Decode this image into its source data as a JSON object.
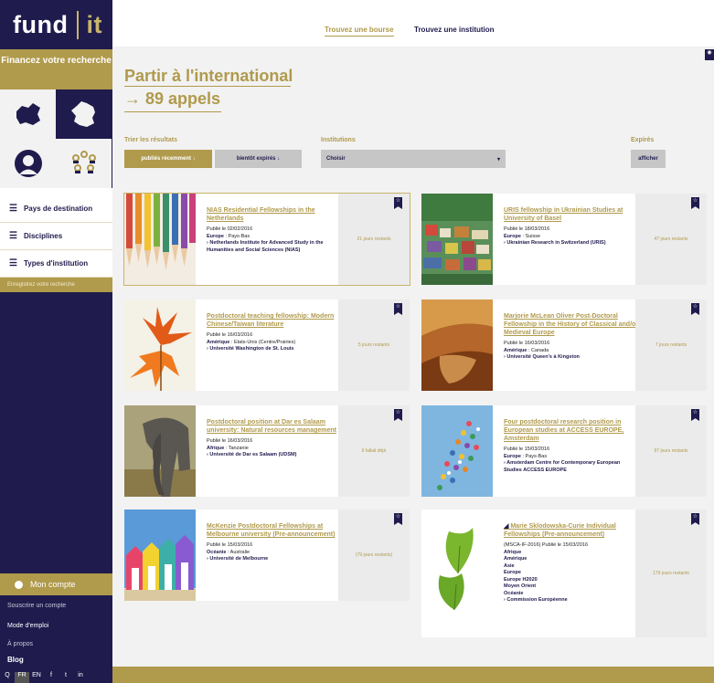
{
  "sidebar": {
    "logo_fund": "fund",
    "logo_it": "it",
    "tagline": "Financez votre recherche",
    "menu": [
      "Pays de destination",
      "Disciplines",
      "Types d'institution"
    ],
    "subscribe": "Enregistrez votre recherche",
    "account": "Mon compte",
    "links": [
      "Souscrire un compte",
      "Mode d'emploi",
      "À propos"
    ],
    "blog": "Blog",
    "social": [
      "Q",
      "FR",
      "EN",
      "f",
      "t",
      "in"
    ]
  },
  "topnav": {
    "bourse": "Trouvez une bourse",
    "institution": "Trouvez une institution"
  },
  "heading": {
    "title": "Partir à l'international",
    "count": "→ 89 appels"
  },
  "filters": {
    "sort_label": "Trier les résultats",
    "sort_recent": "publiés récemment ↓",
    "sort_expiring": "bientôt expirés ↓",
    "institutions_label": "Institutions",
    "institutions_value": "Choisir",
    "expired_label": "Expirés",
    "expired_button": "afficher"
  },
  "cards": [
    {
      "title": "NIAS Residential Fellowships in the Netherlands",
      "published": "Publié le 02/02/2016",
      "region": "Europe",
      "country": " : Pays-Bas",
      "institution": "› Netherlands Institute for Advanced Study in the Humanities and Social Sciences (NIAS)",
      "days": "21 jours restants"
    },
    {
      "title": "URIS fellowship in Ukrainian Studies at University of Basel",
      "published": "Publié le 18/03/2016",
      "region": "Europe",
      "country": " : Suisse",
      "institution": "› Ukrainian Research in Switzerland (URIS)",
      "days": "47 jours restants"
    },
    {
      "title": "Postdoctoral teaching fellowship: Modern Chinese/Taiwan literature",
      "published": "Publié le 16/03/2016",
      "region": "Amérique",
      "country": " : Etats-Unis (Centre/Prairies)",
      "institution": "› Université Washington de St. Louis",
      "days": "5 jours restants"
    },
    {
      "title": "Marjorie McLean Oliver Post-Doctoral Fellowship in the History of Classical and/or Medieval Europe",
      "published": "Publié le 16/03/2016",
      "region": "Amérique",
      "country": " : Canada",
      "institution": "› Université Queen's à Kingston",
      "days": "7 jours restants"
    },
    {
      "title": "Postdoctoral position at Dar es Salaam university: Natural resources management",
      "published": "Publié le 16/03/2016",
      "region": "Afrique",
      "country": " : Tanzanie",
      "institution": "› Université de Dar es Salaam (UDSM)",
      "days": "Il fallait déjà"
    },
    {
      "title": "Four postdoctoral research position in European studies at ACCESS EUROPE, Amsterdam",
      "published": "Publié le 15/03/2016",
      "region": "Europe",
      "country": " : Pays-Bas",
      "institution": "› Amsterdam Centre for Contemporary European Studies ACCESS EUROPE",
      "days": "97 jours restants"
    },
    {
      "title": "McKenzie Postdoctoral Fellowships at Melbourne university (Pre-announcement)",
      "published": "Publié le 15/03/2016",
      "region": "Océanie",
      "country": " : Australie",
      "institution": "› Université de Melbourne",
      "days": "(79 jours restants)"
    },
    {
      "title": "Marie Sklodowska-Curie Individual Fellowships (Pre-announcement)",
      "published": "(MSCA-IF-2016) Publié le 15/03/2016",
      "region": "Afrique",
      "country": "",
      "extra": [
        "Amérique",
        "Asie",
        "Europe",
        "Europe H2020",
        "Moyen Orient",
        "Océanie"
      ],
      "institution": "› Commission Européenne",
      "days": "179 jours restants"
    }
  ],
  "colors": {
    "navy": "#1f1b4d",
    "gold": "#b09a4c",
    "grey": "#c6c6c6"
  }
}
